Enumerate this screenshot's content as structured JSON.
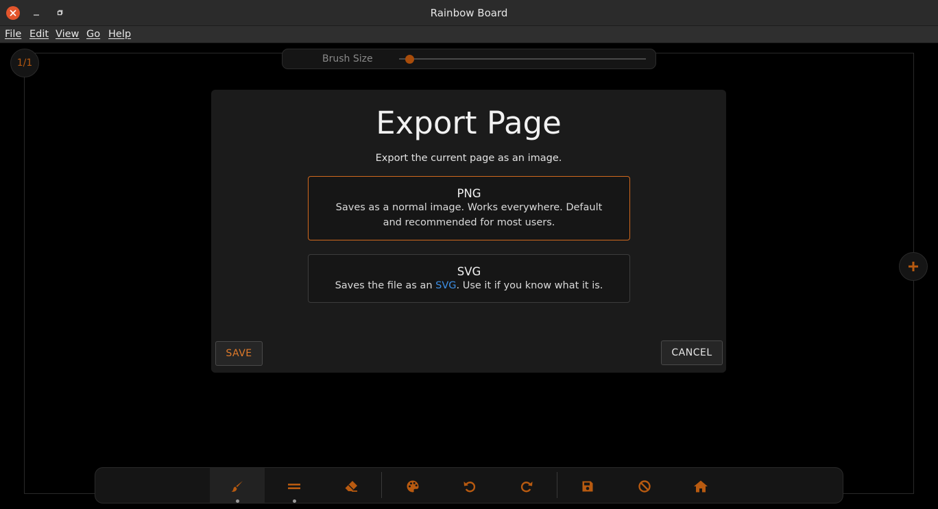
{
  "window": {
    "title": "Rainbow Board"
  },
  "menu": {
    "items": [
      "File",
      "Edit",
      "View",
      "Go",
      "Help"
    ]
  },
  "canvas": {
    "page_counter": "1/1"
  },
  "brush": {
    "label": "Brush Size",
    "value_fraction": 0.03
  },
  "dialog": {
    "title": "Export Page",
    "subtitle": "Export the current page as an image.",
    "options": [
      {
        "title": "PNG",
        "description": "Saves as a normal image. Works everywhere. Default and recommended for most users.",
        "selected": true
      },
      {
        "title": "SVG",
        "description_before": "Saves the file as an ",
        "description_link": "SVG",
        "description_after": ". Use it if you know what it is.",
        "selected": false
      }
    ],
    "save_label": "SAVE",
    "cancel_label": "CANCEL"
  },
  "toolbar": {
    "tools": [
      "brush-icon",
      "line-icon",
      "eraser-icon",
      "palette-icon",
      "undo-icon",
      "redo-icon",
      "save-icon",
      "clear-icon",
      "home-icon"
    ]
  },
  "colors": {
    "accent": "#d2691e",
    "icon": "#b85a10",
    "link": "#3d8fe6",
    "background": "#000000",
    "dialog": "#1b1b1b"
  }
}
